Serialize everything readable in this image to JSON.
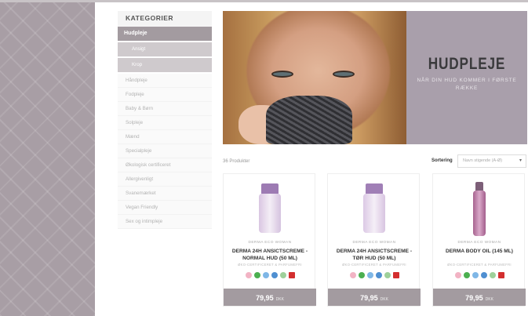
{
  "sidebar": {
    "heading": "KATEGORIER",
    "items": [
      {
        "label": "Hudpleje"
      },
      {
        "label": "Ansigt"
      },
      {
        "label": "Krop"
      },
      {
        "label": "Håndpleje"
      },
      {
        "label": "Fodpleje"
      },
      {
        "label": "Baby & Børn"
      },
      {
        "label": "Solpleje"
      },
      {
        "label": "Mænd"
      },
      {
        "label": "Specialpleje"
      },
      {
        "label": "Økologisk certificeret"
      },
      {
        "label": "Allergivenligt"
      },
      {
        "label": "Svanemærket"
      },
      {
        "label": "Vegan Friendly"
      },
      {
        "label": "Sex og intimpleje"
      }
    ]
  },
  "banner": {
    "title": "HUDPLEJE",
    "subtitle": "NÅR DIN HUD KOMMER I FØRSTE RÆKKE"
  },
  "listing": {
    "count": "36 Produkter",
    "sort_label": "Sortering",
    "sort_value": "Navn stigende (A-Ø)"
  },
  "products": [
    {
      "brand": "DERMA ECO WOMAN",
      "name": "DERMA 24H ANSICTSCREME - NORMAL HUD (50 ML)",
      "cert": "ØKO-CERTIFICERET & PARFUMEFRI",
      "price": "79,95",
      "currency": "DKK",
      "bottle_color": "#c8a6d6",
      "cap_color": "#9d7bb3"
    },
    {
      "brand": "DERMA ECO WOMAN",
      "name": "DERMA 24H ANSICTSCREME - TØR HUD (50 ML)",
      "cert": "ØKO-CERTIFICERET & PARFUMEFRI",
      "price": "79,95",
      "currency": "DKK",
      "bottle_color": "#cbaad8",
      "cap_color": "#a07fb6"
    },
    {
      "brand": "DERMA ECO WOMAN",
      "name": "DERMA BODY OIL (145 ML)",
      "cert": "ØKO-CERTIFICERET & PARFUMEFRI",
      "price": "79,95",
      "currency": "DKK",
      "bottle_color": "#b97ba8",
      "cap_color": "#7d5f78"
    }
  ]
}
